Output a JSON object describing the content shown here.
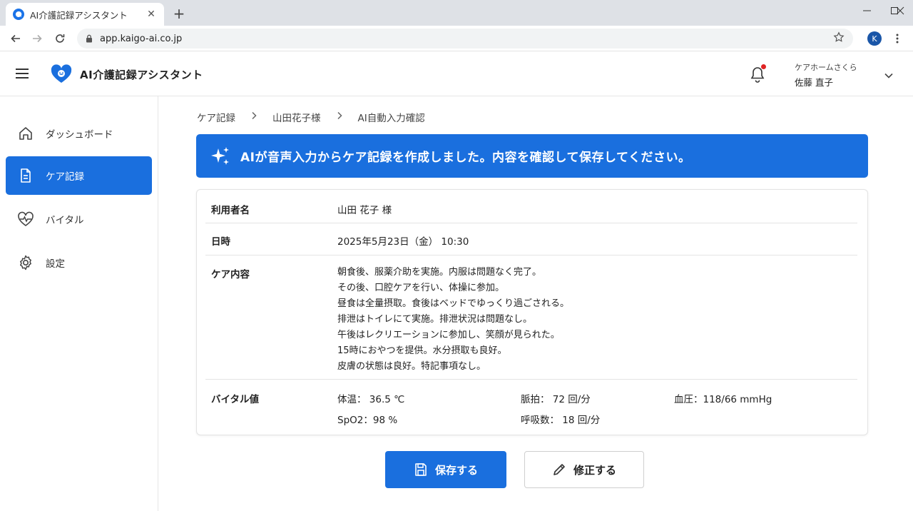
{
  "browser": {
    "tab_title": "AI介護記録アシスタント",
    "url": "app.kaigo-ai.co.jp",
    "profile_initial": "K"
  },
  "header": {
    "app_title": "AI介護記録アシスタント",
    "facility_name": "ケアホームさくら",
    "user_name": "佐藤 直子"
  },
  "sidebar": {
    "items": [
      {
        "label": "ダッシュボード",
        "icon": "home-icon"
      },
      {
        "label": "ケア記録",
        "icon": "document-icon",
        "active": true
      },
      {
        "label": "バイタル",
        "icon": "heart-pulse-icon"
      },
      {
        "label": "設定",
        "icon": "gear-icon"
      }
    ]
  },
  "breadcrumb": [
    "ケア記録",
    "山田花子様",
    "AI自動入力確認"
  ],
  "banner": {
    "icon": "sparkles-icon",
    "text": "AIが音声入力からケア記録を作成しました。内容を確認して保存してください。"
  },
  "record": {
    "user_label": "利用者名",
    "user_value": "山田 花子 様",
    "datetime_label": "日時",
    "datetime_value": "2025年5月23日（金） 10:30",
    "care_label": "ケア内容",
    "care_lines": [
      "朝食後、服薬介助を実施。内服は問題なく完了。",
      "その後、口腔ケアを行い、体操に参加。",
      "昼食は全量摂取。食後はベッドでゆっくり過ごされる。",
      "排泄はトイレにて実施。排泄状況は問題なし。",
      "午後はレクリエーションに参加し、笑顔が見られた。",
      "15時におやつを提供。水分摂取も良好。",
      "皮膚の状態は良好。特記事項なし。"
    ],
    "vitals_label": "バイタル値",
    "vitals": {
      "temp": "体温： 36.5 ℃",
      "pulse": "脈拍： 72 回/分",
      "bp": "血圧：118/66 mmHg",
      "spo2": "SpO2：98 %",
      "resp": "呼吸数： 18 回/分"
    }
  },
  "actions": {
    "save_label": "保存する",
    "edit_label": "修正する"
  },
  "colors": {
    "primary": "#1a6fde",
    "notification": "#e02424"
  }
}
